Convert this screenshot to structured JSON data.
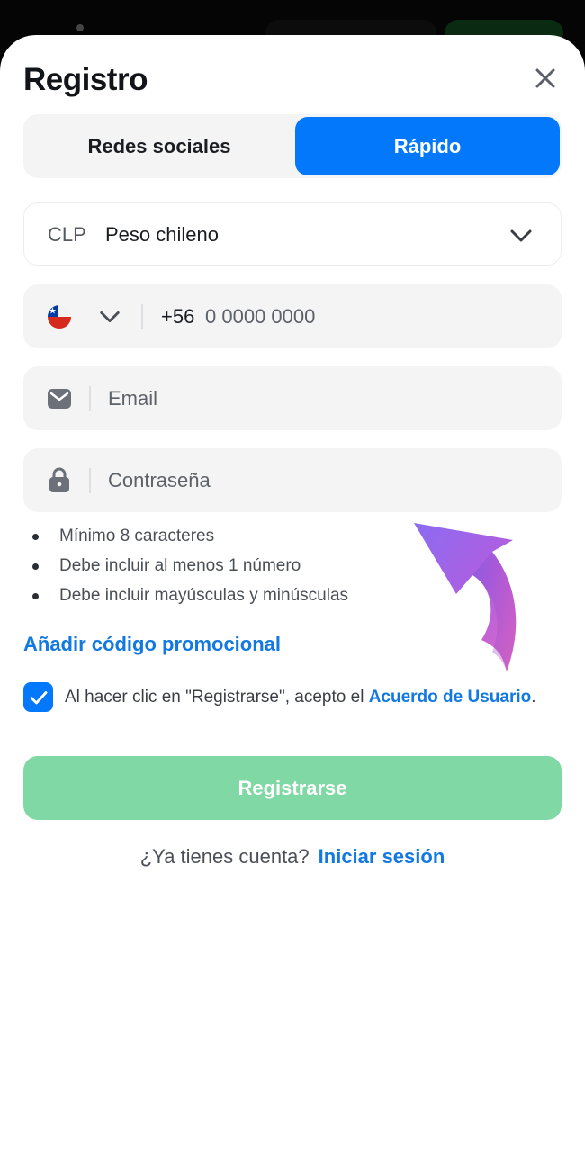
{
  "header": {
    "title": "Registro",
    "close_icon": "close-icon"
  },
  "tabs": [
    {
      "label": "Redes sociales",
      "active": false
    },
    {
      "label": "Rápido",
      "active": true
    }
  ],
  "currency": {
    "code": "CLP",
    "name": "Peso chileno",
    "icon": "chevron-down-icon"
  },
  "phone": {
    "flag_icon": "chile-flag-icon",
    "prefix": "+56",
    "placeholder": "0 0000 0000"
  },
  "email": {
    "icon": "mail-icon",
    "placeholder": "Email"
  },
  "password": {
    "icon": "lock-icon",
    "placeholder": "Contraseña",
    "rules": [
      "Mínimo 8 caracteres",
      "Debe incluir al menos 1 número",
      "Debe incluir mayúsculas y minúsculas"
    ]
  },
  "promo": {
    "label": "Añadir código promocional"
  },
  "terms": {
    "checked": true,
    "text": "Al hacer clic en \"Registrarse\", acepto el ",
    "link": "Acuerdo de Usuario",
    "suffix": "."
  },
  "submit": {
    "label": "Registrarse"
  },
  "login": {
    "question": "¿Ya tienes cuenta?",
    "link": "Iniciar sesión"
  },
  "colors": {
    "accent": "#0378fa",
    "link": "#1279e2",
    "submit_disabled": "#80d9a4",
    "field_bg": "#f4f4f5"
  }
}
